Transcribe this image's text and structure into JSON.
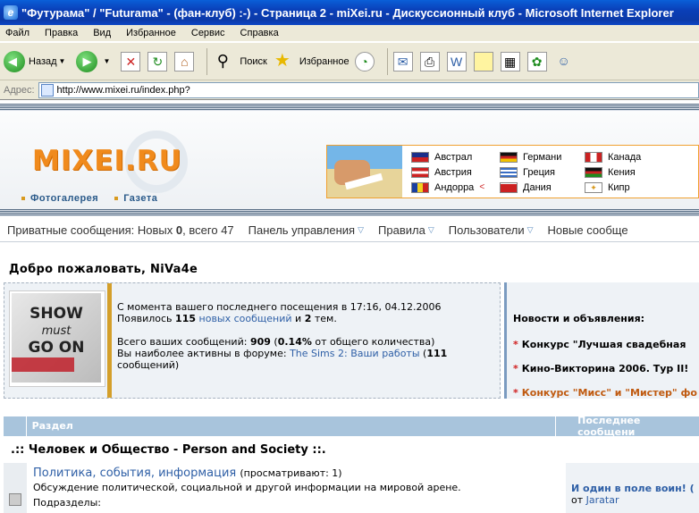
{
  "window": {
    "title": "\"Футурама\" / \"Futurama\" - (фан-клуб) :-) - Страница 2 - miXei.ru - Дискуссионный клуб - Microsoft Internet Explorer"
  },
  "menu": [
    "Файл",
    "Правка",
    "Вид",
    "Избранное",
    "Сервис",
    "Справка"
  ],
  "toolbar": {
    "back": "Назад",
    "search": "Поиск",
    "favorites": "Избранное"
  },
  "address": {
    "label": "Адрес:",
    "url": "http://www.mixei.ru/index.php?"
  },
  "site": {
    "logo": "MIXEI.RU",
    "links": [
      "Фотогалерея",
      "Газета"
    ],
    "countries": [
      {
        "name": "Австрал",
        "colors": [
          "#1a2f8a",
          "#c22"
        ]
      },
      {
        "name": "Австрия",
        "colors": [
          "#c22",
          "#fff"
        ]
      },
      {
        "name": "Андорра",
        "colors": [
          "#1a3fa0",
          "#f2d020"
        ]
      },
      {
        "name": "Германи",
        "colors": [
          "#111",
          "#c22"
        ]
      },
      {
        "name": "Греция",
        "colors": [
          "#3b6fc4",
          "#fff"
        ]
      },
      {
        "name": "Дания",
        "colors": [
          "#c22",
          "#fff"
        ]
      },
      {
        "name": "Канада",
        "colors": [
          "#c22",
          "#fff"
        ]
      },
      {
        "name": "Кения",
        "colors": [
          "#111",
          "#c22"
        ]
      },
      {
        "name": "Кипр",
        "colors": [
          "#fff",
          "#d89a20"
        ]
      }
    ]
  },
  "nav": {
    "pm_label": "Приватные сообщения",
    "pm_new_label": "Новых",
    "pm_new": "0",
    "pm_total_label": "всего",
    "pm_total": "47",
    "items": [
      "Панель управления",
      "Правила",
      "Пользователи",
      "Новые сообще"
    ]
  },
  "welcome": "Добро пожаловать, NiVa4e",
  "info": {
    "avatar_text": [
      "SHOW",
      "must",
      "GO ON"
    ],
    "line1": "С момента вашего последнего посещения в 17:16, 04.12.2006",
    "line2_prefix": "Появилось ",
    "line2_count": "115",
    "line2_link": "новых сообщений",
    "line2_and": " и ",
    "line2_topics": "2",
    "line2_suffix": " тем.",
    "line3_prefix": "Всего ваших сообщений: ",
    "line3_count": "909",
    "line3_pct": "0.14%",
    "line3_suffix": " от общего количества)",
    "line4_prefix": "Вы наиболее активны в форуме: ",
    "line4_link": "The Sims 2: Ваши работы",
    "line4_count": "111",
    "line4_suffix": "сообщений)"
  },
  "news": {
    "title": "Новости и объявления:",
    "items": [
      "Конкурс \"Лучшая свадебная",
      "Кино-Викторина 2006. Тур II!",
      "Конкурс \"Мисс\" и \"Мистер\" фо"
    ]
  },
  "table": {
    "col_section": "Раздел",
    "col_last": "Последнее сообщени"
  },
  "category": ".:: Человек и Общество - Person and Society ::.",
  "forum": {
    "title": "Политика, события, информация",
    "viewing": "(просматривают: 1)",
    "desc": "Обсуждение политической, социальной и другой информации на мировой арене.",
    "subsections": "Подразделы:",
    "last_title": "И один в поле воин! (",
    "last_by_prefix": "от ",
    "last_by": "Jaratar"
  }
}
